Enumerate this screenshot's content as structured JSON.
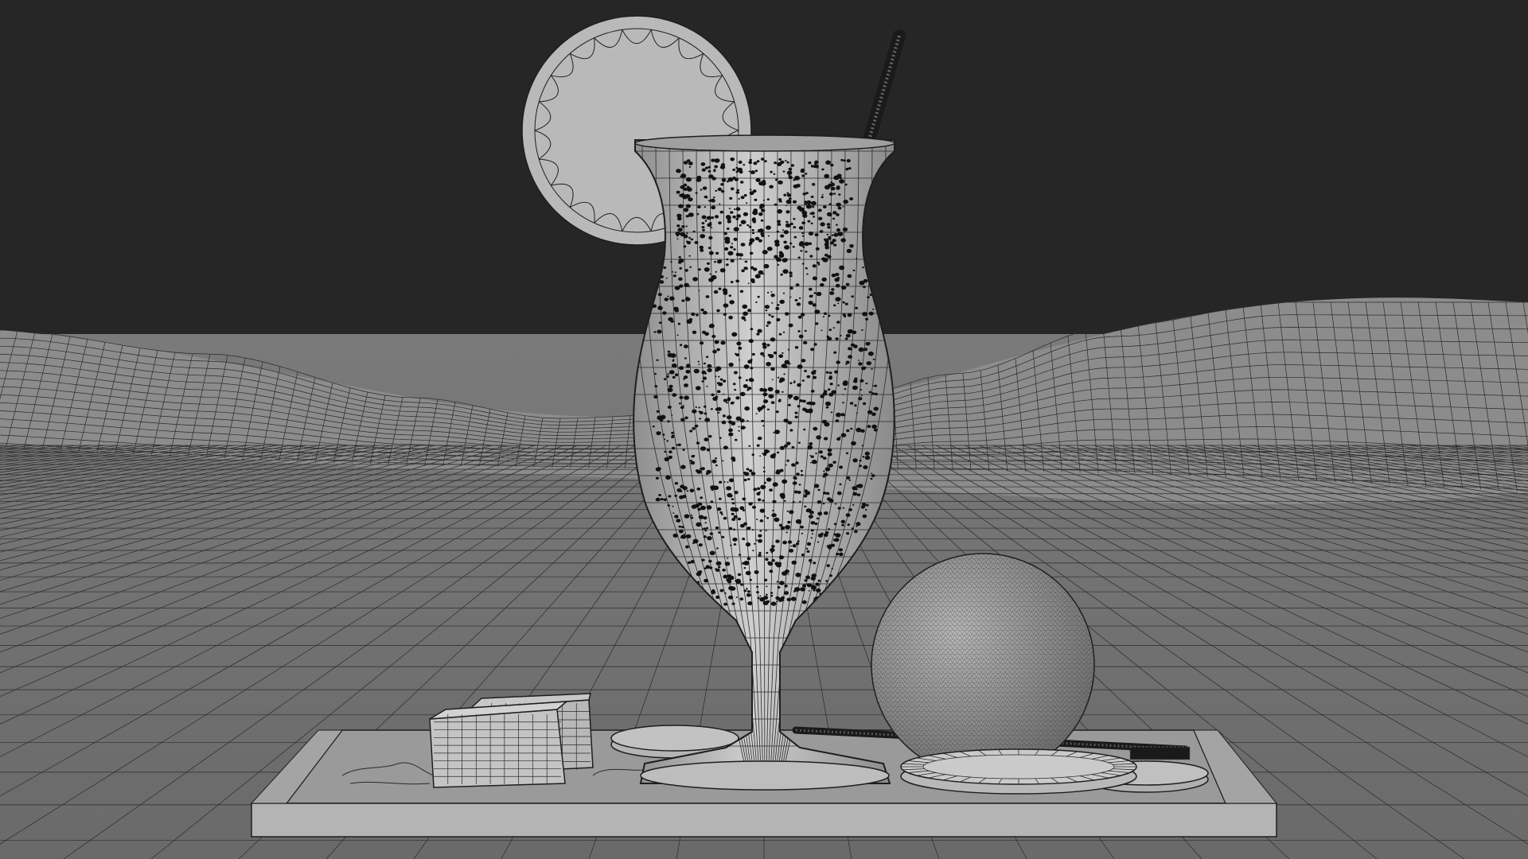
{
  "viewport": {
    "background": "#262626",
    "mesh_fill": "#8e8e8e",
    "wire_color": "#1e1e1e",
    "object_fill": "#a8a8a8",
    "speck_color": "#111111"
  },
  "objects": [
    "backdrop-plane-mesh",
    "hurricane-glass-mesh",
    "lemon-slice-mesh",
    "straw-mesh",
    "sphere-mesh",
    "ice-cube-mesh",
    "serving-board-mesh",
    "coaster-mesh"
  ]
}
